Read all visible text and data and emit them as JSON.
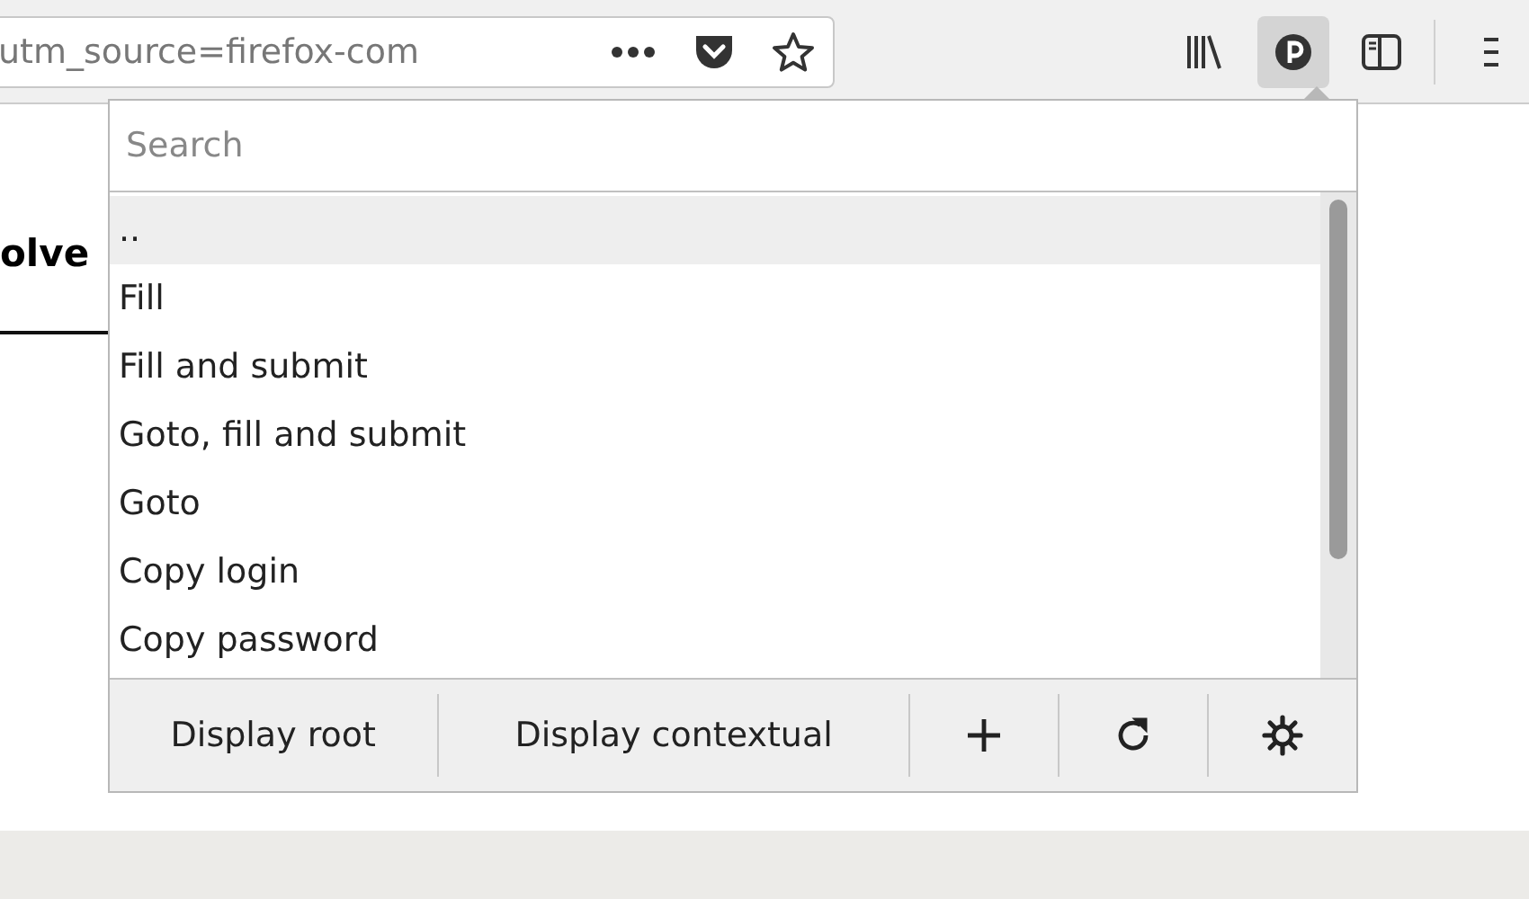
{
  "address_bar": {
    "url": "utm_source=firefox-com"
  },
  "toolbar": [
    {
      "kind": "library"
    },
    {
      "kind": "extension",
      "pressed": true
    },
    {
      "kind": "sidebar"
    },
    {
      "kind": "menu"
    }
  ],
  "page": {
    "heading_fragment": "olve"
  },
  "popup": {
    "search": {
      "placeholder": "Search"
    },
    "items": [
      {
        "label": "..",
        "selected": true
      },
      {
        "label": "Fill",
        "selected": false
      },
      {
        "label": "Fill and submit",
        "selected": false
      },
      {
        "label": "Goto, fill and submit",
        "selected": false
      },
      {
        "label": "Goto",
        "selected": false
      },
      {
        "label": "Copy login",
        "selected": false
      },
      {
        "label": "Copy password",
        "selected": false
      }
    ],
    "buttons": [
      {
        "kind": "text",
        "label": "Display root"
      },
      {
        "kind": "text",
        "label": "Display contextual"
      },
      {
        "kind": "add"
      },
      {
        "kind": "refresh"
      },
      {
        "kind": "settings"
      }
    ]
  }
}
